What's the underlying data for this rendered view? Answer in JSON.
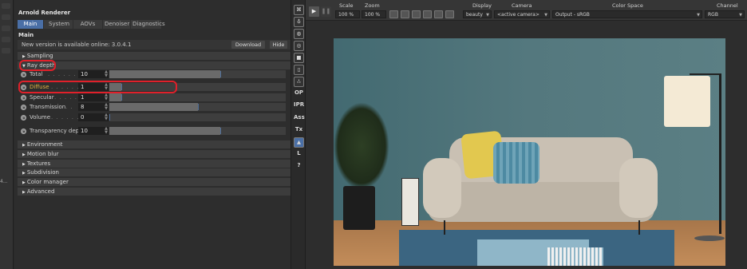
{
  "panel": {
    "title": "Arnold Renderer",
    "tabs": [
      {
        "label": "Main",
        "active": true
      },
      {
        "label": "System",
        "active": false
      },
      {
        "label": "AOVs",
        "active": false
      },
      {
        "label": "Denoiser",
        "active": false
      },
      {
        "label": "Diagnostics",
        "active": false
      }
    ],
    "section_label": "Main",
    "update_notice": "New version is available online: 3.0.4.1",
    "download_label": "Download",
    "hide_label": "Hide",
    "sections_top": [
      {
        "label": "Sampling",
        "expanded": false
      },
      {
        "label": "Ray depth",
        "expanded": true
      }
    ],
    "ray_depth_params": [
      {
        "label": "Total",
        "value": "10",
        "fill": 0.63
      },
      {
        "label": "Diffuse",
        "value": "1",
        "fill": 0.07
      },
      {
        "label": "Specular",
        "value": "1",
        "fill": 0.07
      },
      {
        "label": "Transmission",
        "value": "8",
        "fill": 0.5
      },
      {
        "label": "Volume",
        "value": "0",
        "fill": 0.0
      },
      {
        "label": "Transparency depth",
        "value": "10",
        "fill": 0.63
      }
    ],
    "sections_bottom": [
      {
        "label": "Environment"
      },
      {
        "label": "Motion blur"
      },
      {
        "label": "Textures"
      },
      {
        "label": "Subdivision"
      },
      {
        "label": "Color manager"
      },
      {
        "label": "Advanced"
      }
    ]
  },
  "icon_column": [
    "OP",
    "IPR",
    "Ass",
    "Tx",
    "L",
    "?"
  ],
  "left_strip_label": "4...",
  "viewer": {
    "scale_header": "Scale",
    "scale_value": "100 %",
    "zoom_header": "Zoom",
    "zoom_value": "100 %",
    "display_header": "Display",
    "display_value": "beauty",
    "camera_header": "Camera",
    "camera_value": "<active camera>",
    "colorspace_header": "Color Space",
    "colorspace_value": "Output - sRGB",
    "channel_header": "Channel",
    "channel_value": "RGB"
  }
}
